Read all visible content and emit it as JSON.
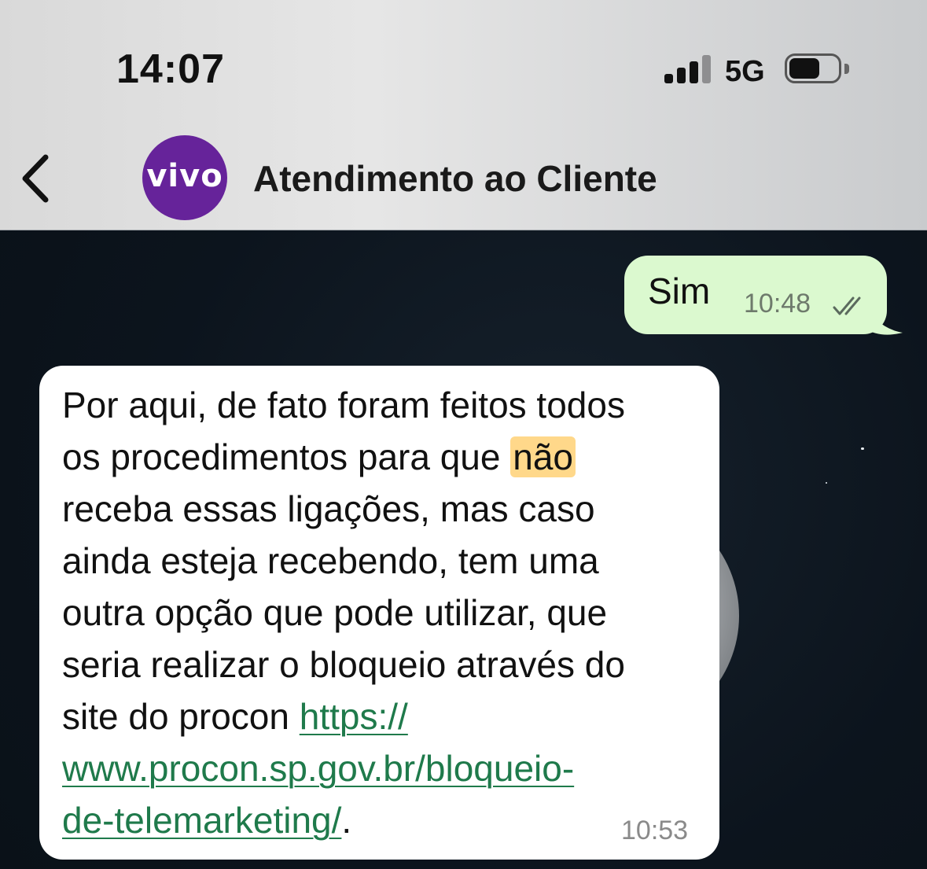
{
  "status_bar": {
    "time": "14:07",
    "network": "5G",
    "signal_bars_active": 3,
    "signal_bars_total": 4,
    "battery_level": 0.5
  },
  "nav": {
    "back_icon": "chevron-left-icon",
    "avatar_text": "vivo",
    "avatar_color": "#66239a",
    "contact_name": "Atendimento ao Cliente"
  },
  "messages": {
    "outgoing": {
      "text": "Sim",
      "time": "10:48",
      "status_icon": "double-check-icon",
      "bubble_color": "#dbf9cf"
    },
    "incoming": {
      "line1": "Por aqui, de fato foram feitos todos",
      "line2_before": "os procedimentos para que ",
      "line2_highlight": "não",
      "line3": "receba essas ligações, mas caso",
      "line4": "ainda esteja recebendo, tem uma",
      "line5": "outra opção que pode utilizar, que",
      "line6": "seria realizar o bloqueio através do",
      "line7_before": "site do procon ",
      "link_part1": "https://",
      "link_part2": "www.procon.sp.gov.br/bloqueio-",
      "link_part3": "de-telemarketing/",
      "trailing": ".",
      "time": "10:53",
      "highlight_color": "#ffd88a",
      "link_color": "#1f7a4b"
    }
  }
}
